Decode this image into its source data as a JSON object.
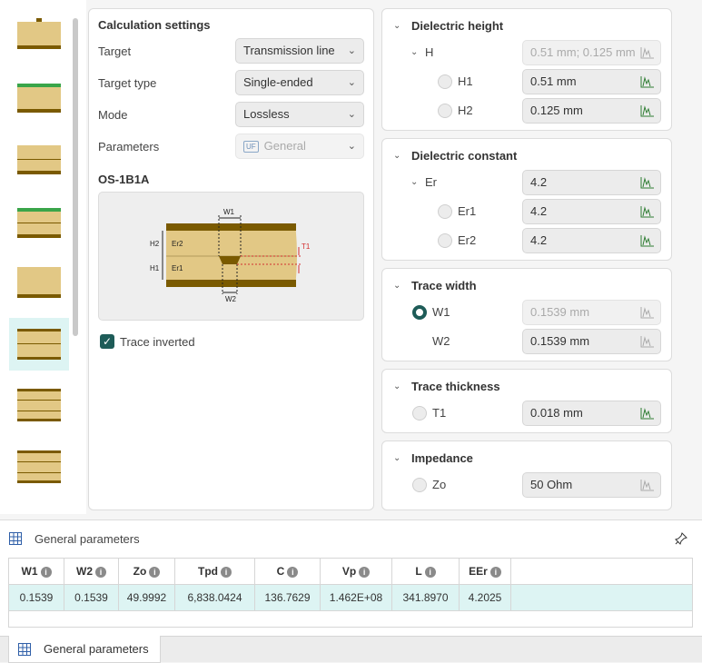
{
  "calc": {
    "title": "Calculation settings",
    "target_label": "Target",
    "target_value": "Transmission line",
    "target_type_label": "Target type",
    "target_type_value": "Single-ended",
    "mode_label": "Mode",
    "mode_value": "Lossless",
    "parameters_label": "Parameters",
    "parameters_badge": "UF",
    "parameters_value": "General",
    "structure_name": "OS-1B1A",
    "trace_inverted_label": "Trace inverted",
    "trace_inverted_checked": true
  },
  "diagram_labels": {
    "w1": "W1",
    "w2": "W2",
    "h1": "H1",
    "h2": "H2",
    "er1": "Er1",
    "er2": "Er2",
    "t1": "T1"
  },
  "dielectric_height": {
    "title": "Dielectric height",
    "h_label": "H",
    "h_value": "0.51 mm; 0.125 mm",
    "h1_label": "H1",
    "h1_value": "0.51 mm",
    "h2_label": "H2",
    "h2_value": "0.125 mm"
  },
  "dielectric_constant": {
    "title": "Dielectric constant",
    "er_label": "Er",
    "er_value": "4.2",
    "er1_label": "Er1",
    "er1_value": "4.2",
    "er2_label": "Er2",
    "er2_value": "4.2"
  },
  "trace_width": {
    "title": "Trace width",
    "w1_label": "W1",
    "w1_value": "0.1539 mm",
    "w2_label": "W2",
    "w2_value": "0.1539 mm"
  },
  "trace_thickness": {
    "title": "Trace thickness",
    "t1_label": "T1",
    "t1_value": "0.018 mm"
  },
  "impedance": {
    "title": "Impedance",
    "zo_label": "Zo",
    "zo_value": "50 Ohm"
  },
  "results": {
    "title": "General parameters",
    "columns": [
      "W1",
      "W2",
      "Zo",
      "Tpd",
      "C",
      "Vp",
      "L",
      "EEr"
    ],
    "row": [
      "0.1539",
      "0.1539",
      "49.9992",
      "6,838.0424",
      "136.7629",
      "1.462E+08",
      "341.8970",
      "4.2025"
    ]
  },
  "tab_label": "General parameters",
  "colors": {
    "accent": "#1e5c58",
    "selected_row": "#ddf4f3",
    "active_chart_icon": "#2e7d32"
  }
}
